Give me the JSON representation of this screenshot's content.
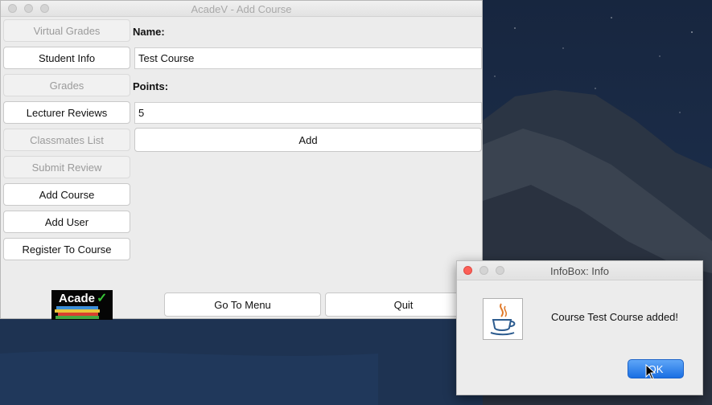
{
  "main_window": {
    "title": "AcadeV - Add Course",
    "sidebar": [
      {
        "label": "Virtual Grades",
        "enabled": false
      },
      {
        "label": "Student Info",
        "enabled": true
      },
      {
        "label": "Grades",
        "enabled": false
      },
      {
        "label": "Lecturer Reviews",
        "enabled": true
      },
      {
        "label": "Classmates List",
        "enabled": false
      },
      {
        "label": "Submit Review",
        "enabled": false
      },
      {
        "label": "Add Course",
        "enabled": true
      },
      {
        "label": "Add User",
        "enabled": true
      },
      {
        "label": "Register To Course",
        "enabled": true
      }
    ],
    "form": {
      "name_label": "Name:",
      "name_value": "Test Course",
      "points_label": "Points:",
      "points_value": "5",
      "add_label": "Add"
    },
    "footer": {
      "menu_label": "Go To Menu",
      "quit_label": "Quit"
    },
    "logo_text": "Acade"
  },
  "dialog": {
    "title": "InfoBox: Info",
    "message": "Course Test Course added!",
    "ok_label": "OK",
    "icon": "java-icon"
  },
  "colors": {
    "accent": "#1a6fe3",
    "close_red": "#fc5f57"
  }
}
